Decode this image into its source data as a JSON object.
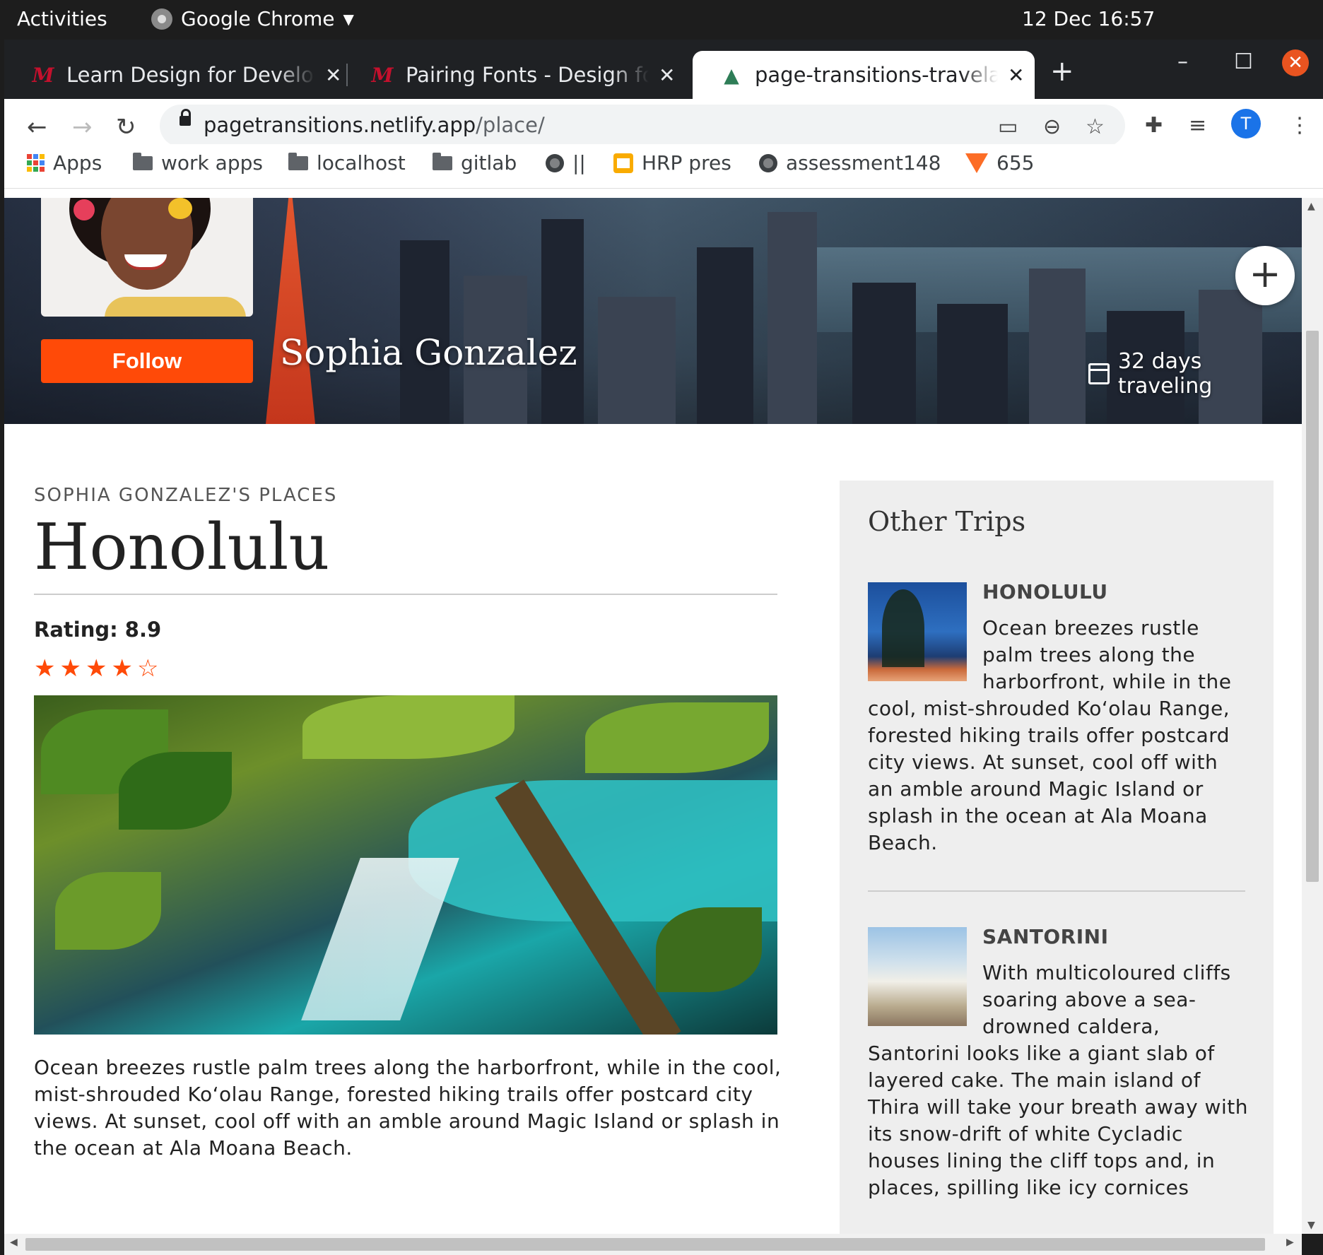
{
  "os": {
    "activities": "Activities",
    "app_menu": "Google Chrome",
    "datetime": "12 Dec  16:57"
  },
  "tabs": [
    {
      "title": "Learn Design for Developers",
      "favicon": "M",
      "active": false
    },
    {
      "title": "Pairing Fonts - Design for Developers",
      "favicon": "M",
      "active": false
    },
    {
      "title": "page-transitions-travelapp",
      "favicon": "netlify-icon",
      "active": true
    }
  ],
  "address_bar": {
    "host": "pagetransitions.netlify.app",
    "path": "/place/"
  },
  "profile_initial": "T",
  "bookmarks": [
    {
      "label": "Apps",
      "icon": "apps-grid-icon"
    },
    {
      "label": "work apps",
      "icon": "folder-icon"
    },
    {
      "label": "localhost",
      "icon": "folder-icon"
    },
    {
      "label": "gitlab",
      "icon": "folder-icon"
    },
    {
      "label": "||",
      "icon": "globe-icon"
    },
    {
      "label": "HRP pres",
      "icon": "slides-icon"
    },
    {
      "label": "assessment148",
      "icon": "globe-icon"
    },
    {
      "label": "655",
      "icon": "gitlab-icon"
    }
  ],
  "profile": {
    "name": "Sophia Gonzalez",
    "follow_label": "Follow",
    "days_traveling": "32 days traveling"
  },
  "place": {
    "section_label": "SOPHIA GONZALEZ'S PLACES",
    "title": "Honolulu",
    "rating_label": "Rating: 8.9",
    "rating_value": 8.9,
    "stars_filled": 4,
    "stars_total": 5,
    "description": "Ocean breezes rustle palm trees along the harborfront, while in the cool, mist-shrouded Ko‘olau Range, forested hiking trails offer postcard city views. At sunset, cool off with an amble around Magic Island or splash in the ocean at Ala Moana Beach."
  },
  "sidebar": {
    "title": "Other Trips",
    "trips": [
      {
        "name": "HONOLULU",
        "description": "Ocean breezes rustle palm trees along the harborfront, while in the cool, mist-shrouded Ko‘olau Range, forested hiking trails offer postcard city views. At sunset, cool off with an amble around Magic Island or splash in the ocean at Ala Moana Beach."
      },
      {
        "name": "SANTORINI",
        "description": "With multicoloured cliffs soaring above a sea-drowned caldera, Santorini looks like a giant slab of layered cake. The main island of Thira will take your breath away with its snow-drift of white Cycladic houses lining the cliff tops and, in places, spilling like icy cornices"
      }
    ]
  },
  "colors": {
    "accent": "#ff4a08",
    "sidebar_bg": "#eeeeee",
    "tabstrip_bg": "#1f2124"
  }
}
